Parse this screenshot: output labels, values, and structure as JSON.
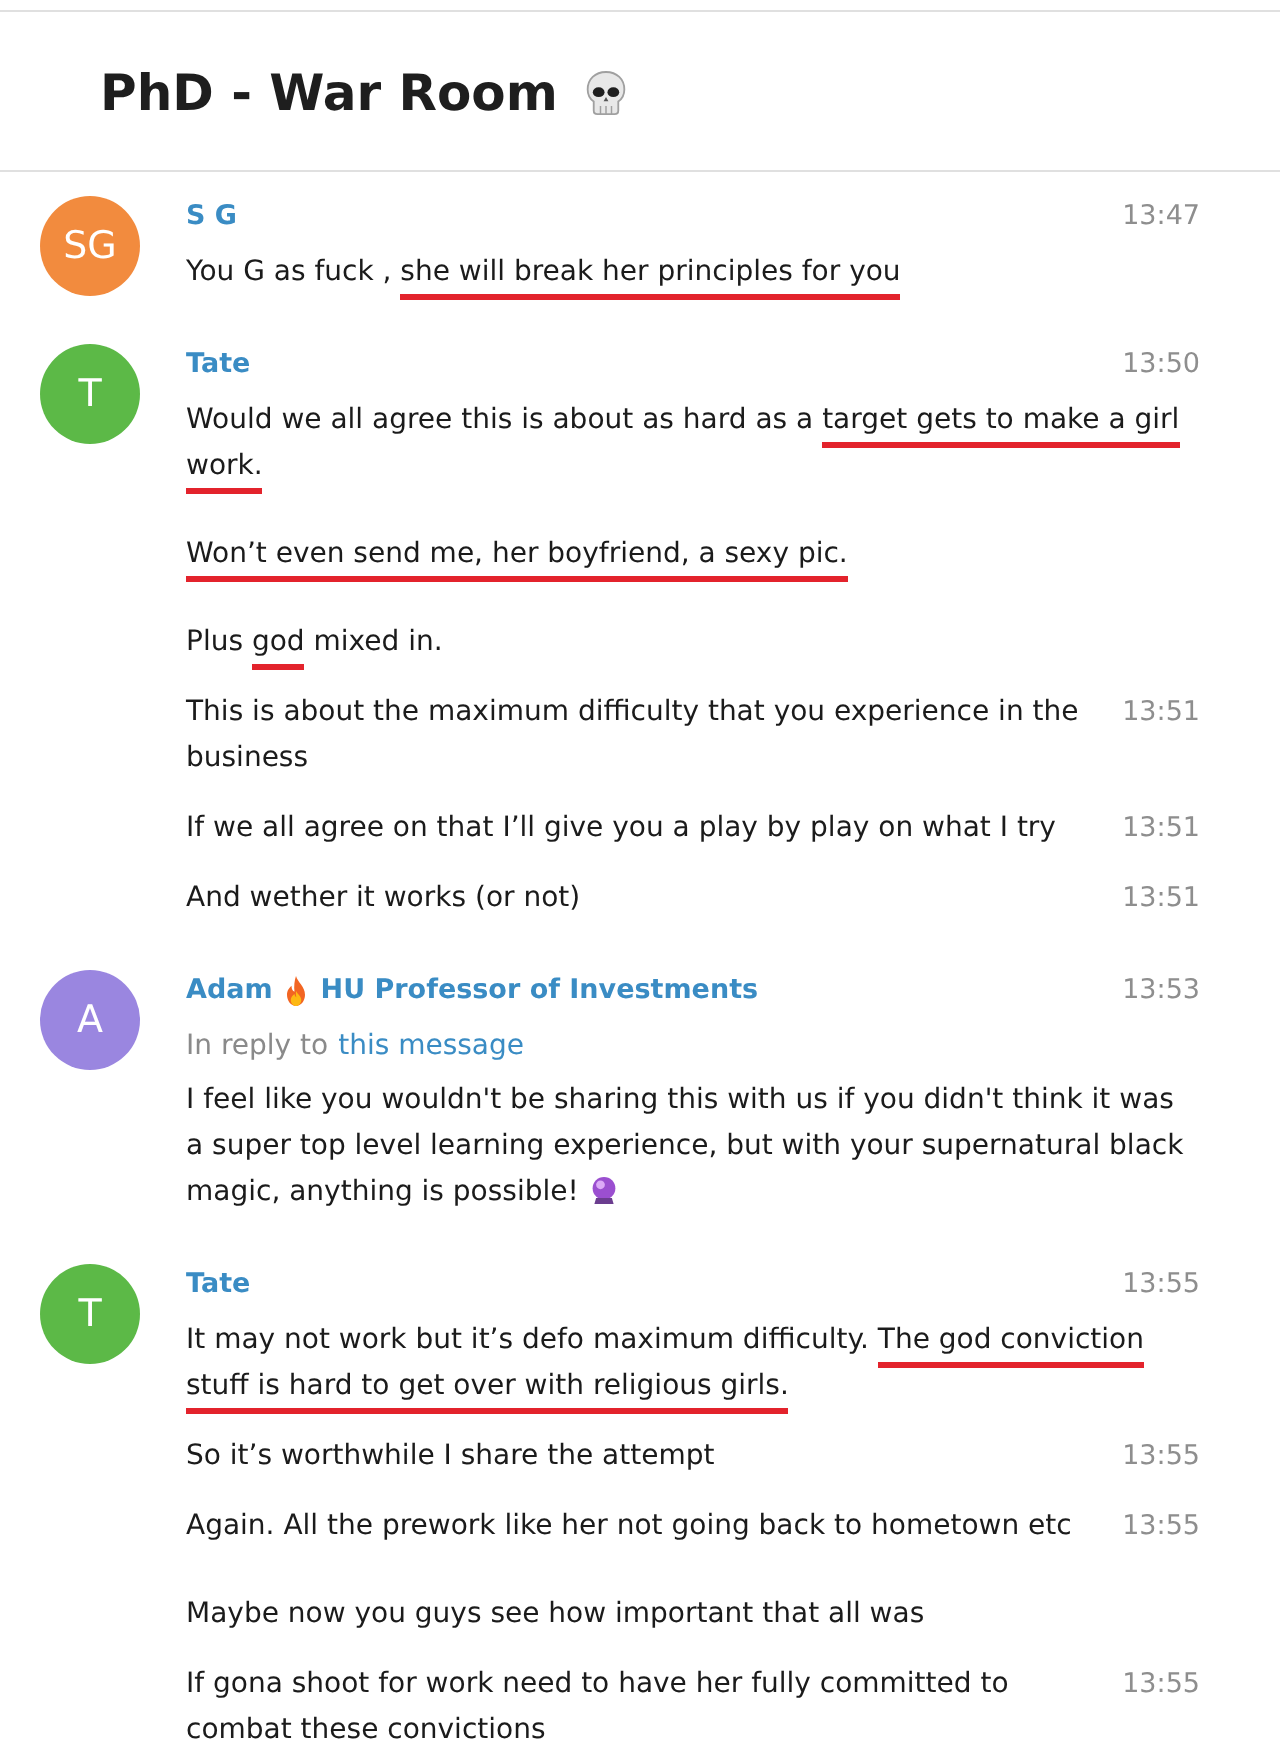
{
  "header": {
    "title": "PhD - War Room"
  },
  "groups": [
    {
      "avatar": {
        "initials": "SG",
        "color": "#f28b3e"
      },
      "sender": {
        "name": "S G"
      },
      "time": "13:47",
      "messages": [
        {
          "parts": [
            {
              "text": "You G as fuck , ",
              "underlined": false
            },
            {
              "text": "she will break her principles for you",
              "underlined": true
            }
          ],
          "trailing_icon": false
        }
      ]
    },
    {
      "avatar": {
        "initials": "T",
        "color": "#5cb947"
      },
      "sender": {
        "name": "Tate"
      },
      "time": "13:50",
      "messages": [
        {
          "parts": [
            {
              "text": "Would we all agree this is about as hard as a ",
              "underlined": false
            },
            {
              "text": "target gets to make a girl work.",
              "underlined": true
            }
          ],
          "trailing_icon": false
        },
        {
          "parts": [
            {
              "text": "Won’t even send me, her boyfriend, a sexy pic.",
              "underlined": true
            }
          ],
          "trailing_icon": false
        },
        {
          "parts": [
            {
              "text": "Plus ",
              "underlined": false
            },
            {
              "text": "god",
              "underlined": true
            },
            {
              "text": " mixed in.",
              "underlined": false
            }
          ],
          "trailing_icon": false
        },
        {
          "time": "13:51",
          "parts": [
            {
              "text": "This is about the maximum difficulty that you experience in the business",
              "underlined": false
            }
          ],
          "trailing_icon": false
        },
        {
          "time": "13:51",
          "parts": [
            {
              "text": "If we all agree on that I’ll give you a play by play on what I try",
              "underlined": false
            }
          ],
          "trailing_icon": false
        },
        {
          "time": "13:51",
          "parts": [
            {
              "text": "And wether it works (or not)",
              "underlined": false
            }
          ],
          "trailing_icon": false
        }
      ]
    },
    {
      "avatar": {
        "initials": "A",
        "color": "#9a86e0"
      },
      "sender": {
        "name": "Adam",
        "title": "HU Professor of Investments"
      },
      "time": "13:53",
      "reply_to": {
        "label": "In reply to",
        "link": "this message"
      },
      "messages": [
        {
          "parts": [
            {
              "text": "I feel like you wouldn't be sharing this with us if you didn't think it was a super top level learning experience, but with your supernatural black magic, anything is possible!",
              "underlined": false
            }
          ],
          "trailing_icon": true
        }
      ]
    },
    {
      "avatar": {
        "initials": "T",
        "color": "#5cb947"
      },
      "sender": {
        "name": "Tate"
      },
      "time": "13:55",
      "messages": [
        {
          "parts": [
            {
              "text": "It may not work but it’s defo maximum difficulty. ",
              "underlined": false
            },
            {
              "text": "The god conviction stuff is hard to get over with religious girls.",
              "underlined": true
            }
          ],
          "trailing_icon": false
        },
        {
          "time": "13:55",
          "parts": [
            {
              "text": "So it’s worthwhile I share the attempt",
              "underlined": false
            }
          ],
          "trailing_icon": false
        },
        {
          "time": "13:55",
          "parts": [
            {
              "text": "Again. All the prework like her not going back to hometown etc",
              "underlined": false
            }
          ],
          "trailing_icon": false
        },
        {
          "parts": [
            {
              "text": "Maybe now you guys see how important that all was",
              "underlined": false
            }
          ],
          "trailing_icon": false
        },
        {
          "time": "13:55",
          "parts": [
            {
              "text": "If gona shoot for work need to have her fully committed to combat these convictions",
              "underlined": false
            }
          ],
          "trailing_icon": false
        }
      ]
    }
  ]
}
